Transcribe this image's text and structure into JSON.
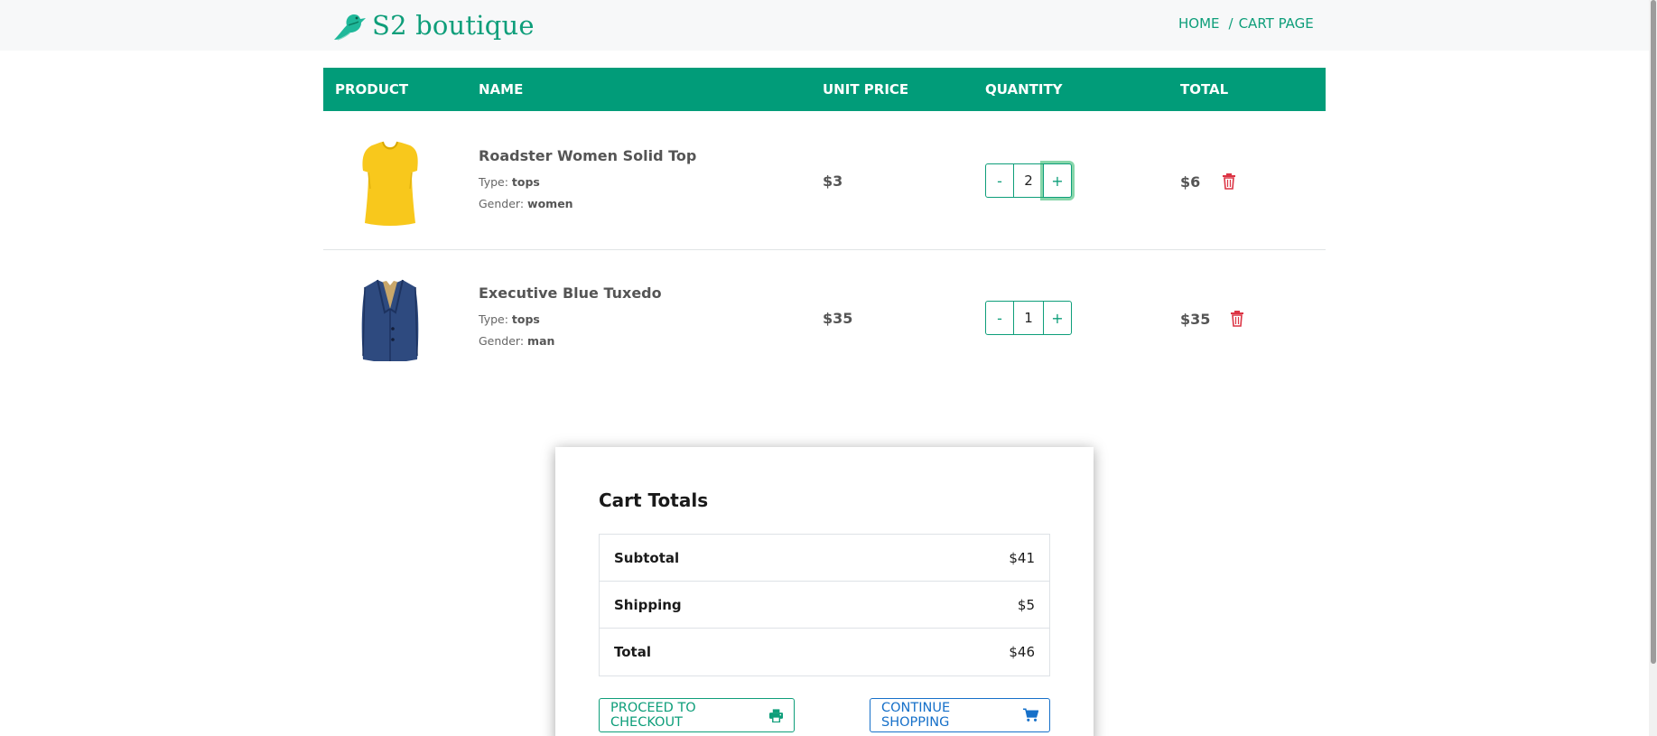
{
  "header": {
    "brand": "S2 boutique",
    "breadcrumb": {
      "home": "HOME",
      "separator": "/",
      "current": "CART PAGE"
    }
  },
  "cart": {
    "columns": {
      "product": "PRODUCT",
      "name": "NAME",
      "unit_price": "UNIT PRICE",
      "quantity": "QUANTITY",
      "total": "TOTAL"
    },
    "items": [
      {
        "name": "Roadster Women Solid Top",
        "type_label": "Type:",
        "type": "tops",
        "gender_label": "Gender:",
        "gender": "women",
        "unit_price": "$3",
        "quantity": "2",
        "total": "$6",
        "image_icon": "yellow-tshirt"
      },
      {
        "name": "Executive Blue Tuxedo",
        "type_label": "Type:",
        "type": "tops",
        "gender_label": "Gender:",
        "gender": "man",
        "unit_price": "$35",
        "quantity": "1",
        "total": "$35",
        "image_icon": "blue-blazer"
      }
    ],
    "minus_label": "-",
    "plus_label": "+"
  },
  "totals": {
    "title": "Cart Totals",
    "rows": [
      {
        "label": "Subtotal",
        "value": "$41"
      },
      {
        "label": "Shipping",
        "value": "$5"
      },
      {
        "label": "Total",
        "value": "$46"
      }
    ],
    "checkout_label": "PROCEED TO CHECKOUT",
    "continue_label": "CONTINUE SHOPPING"
  },
  "colors": {
    "brand": "#0e9e7a",
    "table_header": "#019c79",
    "delete": "#dc3545",
    "continue": "#1670c9"
  }
}
